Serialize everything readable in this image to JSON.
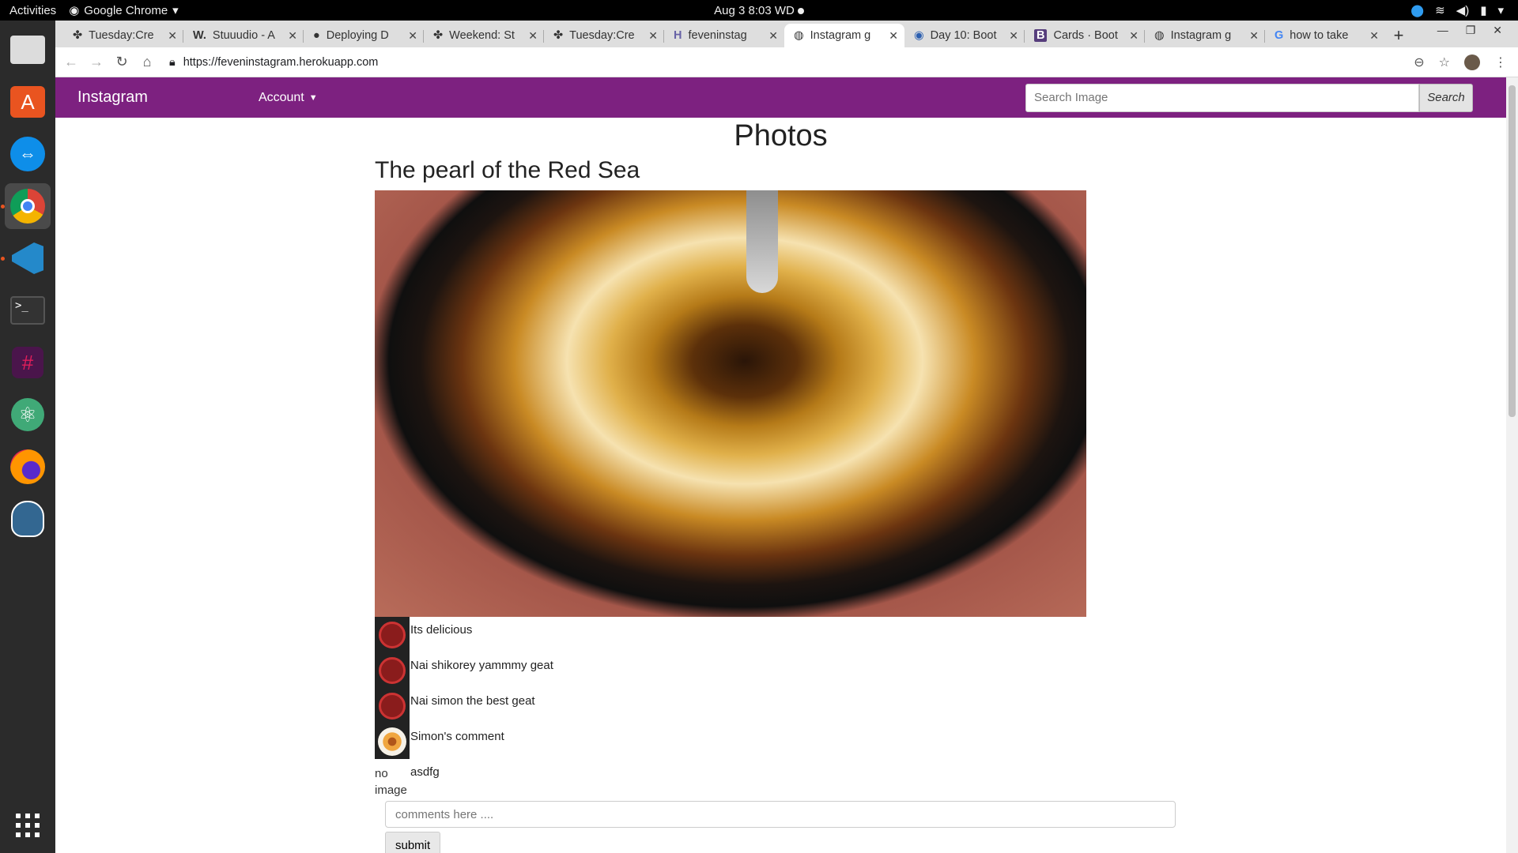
{
  "topbar": {
    "activities": "Activities",
    "app": "Google Chrome",
    "clock": "Aug 3  8:03 WD"
  },
  "dock": {
    "items": [
      "files-icon",
      "software-center-icon",
      "teamviewer-icon",
      "chrome-icon",
      "vscode-icon",
      "terminal-icon",
      "slack-icon",
      "atom-icon",
      "firefox-icon",
      "postgres-icon"
    ],
    "show_apps": "apps-grid-icon"
  },
  "browser": {
    "tabs": [
      {
        "label": "Tuesday:Cre"
      },
      {
        "label": "Stuuudio - A"
      },
      {
        "label": "Deploying D"
      },
      {
        "label": "Weekend: St"
      },
      {
        "label": "Tuesday:Cre"
      },
      {
        "label": "feveninstag"
      },
      {
        "label": "Instagram g"
      },
      {
        "label": "Day 10: Boot"
      },
      {
        "label": "Cards · Boot"
      },
      {
        "label": "Instagram g"
      },
      {
        "label": "how to take"
      }
    ],
    "url": "https://feveninstagram.herokuapp.com"
  },
  "site": {
    "brand": "Instagram",
    "account": "Account",
    "search_placeholder": "Search Image",
    "search_button": "Search",
    "accent": "#7d2180"
  },
  "page": {
    "heading": "Photos",
    "post_title": "The pearl of the Red Sea",
    "comments": [
      {
        "text": "Its delicious",
        "avatar": "codewars"
      },
      {
        "text": "Nai shikorey yammmy geat",
        "avatar": "codewars"
      },
      {
        "text": "Nai simon the best geat",
        "avatar": "codewars"
      },
      {
        "text": "Simon's comment",
        "avatar": "flower"
      },
      {
        "text": "asdfg",
        "avatar": "none",
        "alt": "no image"
      }
    ],
    "comment_placeholder": "comments here ....",
    "submit": "submit"
  }
}
